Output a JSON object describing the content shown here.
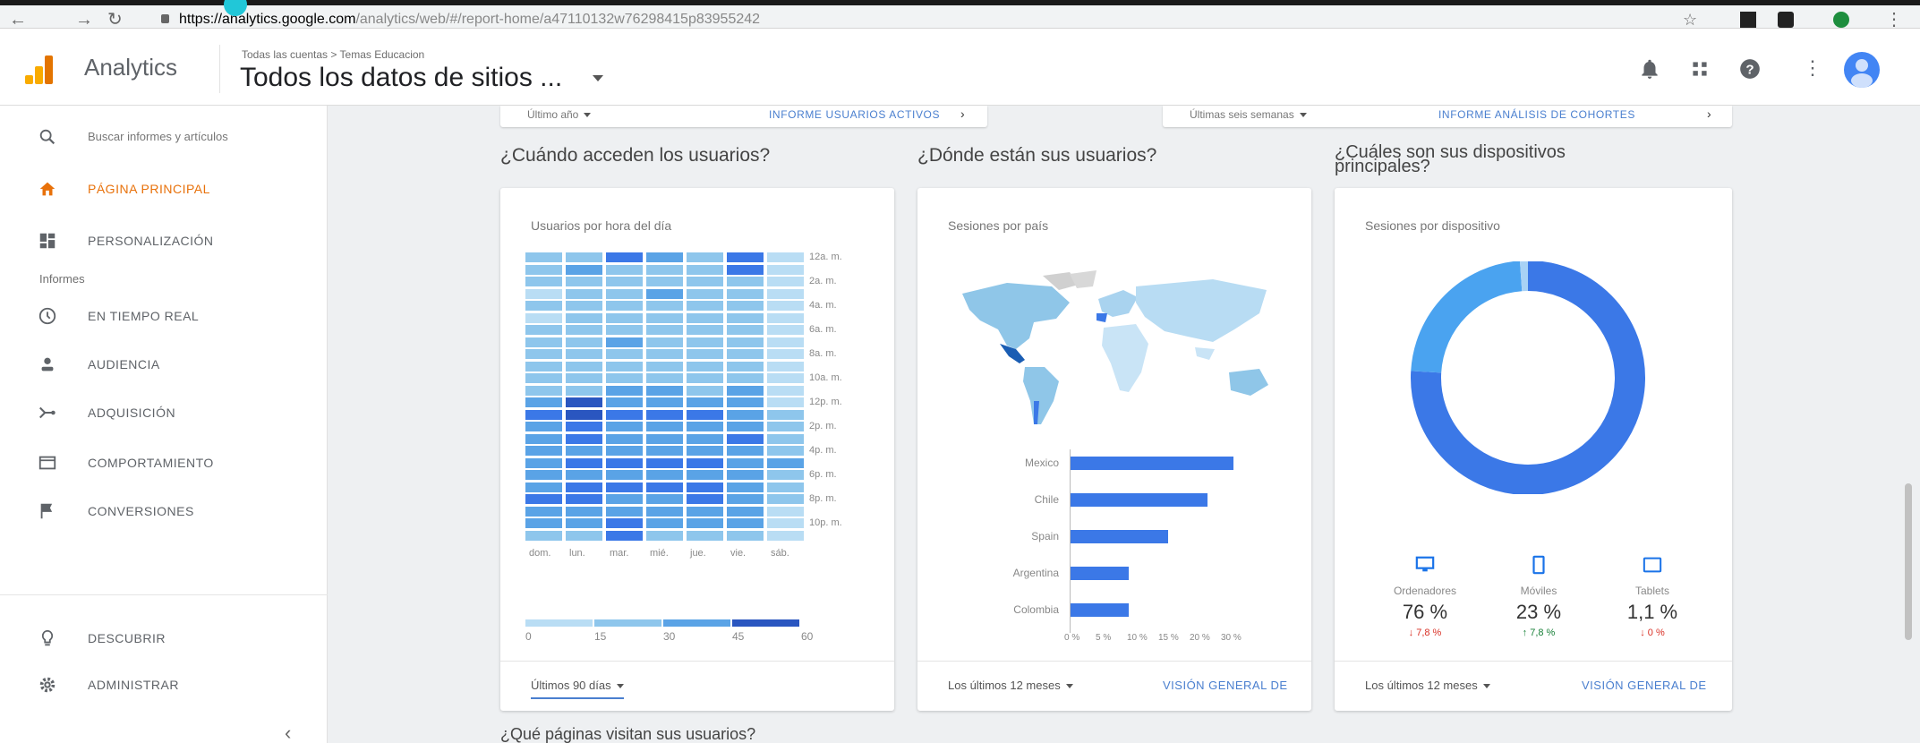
{
  "browser": {
    "url_host": "https://analytics.google.com",
    "url_rest": "/analytics/web/#/report-home/a47110132w76298415p83955242"
  },
  "header": {
    "app_name": "Analytics",
    "breadcrumb": "Todas las cuentas > Temas Educacion",
    "view_name": "Todos los datos de sitios ..."
  },
  "sidebar": {
    "search": "Buscar informes y artículos",
    "home": "PÁGINA PRINCIPAL",
    "customization": "PERSONALIZACIÓN",
    "reports_section": "Informes",
    "realtime": "EN TIEMPO REAL",
    "audience": "AUDIENCIA",
    "acquisition": "ADQUISICIÓN",
    "behavior": "COMPORTAMIENTO",
    "conversions": "CONVERSIONES",
    "discover": "DESCUBRIR",
    "admin": "ADMINISTRAR",
    "collapse": "‹"
  },
  "top_cards": {
    "left_select": "Último año",
    "left_link": "INFORME USUARIOS ACTIVOS",
    "right_select": "Últimas seis semanas",
    "right_link": "INFORME ANÁLISIS DE COHORTES"
  },
  "questions": {
    "when": "¿Cuándo acceden los usuarios?",
    "where": "¿Dónde están sus usuarios?",
    "devices": "¿Cuáles son sus dispositivos principales?",
    "pages": "¿Qué páginas visitan sus usuarios?"
  },
  "when_card": {
    "title": "Usuarios por hora del día",
    "hours": [
      "12a. m.",
      "2a. m.",
      "4a. m.",
      "6a. m.",
      "8a. m.",
      "10a. m.",
      "12p. m.",
      "2p. m.",
      "4p. m.",
      "6p. m.",
      "8p. m.",
      "10p. m."
    ],
    "days": [
      "dom.",
      "lun.",
      "mar.",
      "mié.",
      "jue.",
      "vie.",
      "sáb."
    ],
    "legend": [
      "0",
      "15",
      "30",
      "45",
      "60"
    ],
    "footer": "Últimos 90 días"
  },
  "where_card": {
    "title": "Sesiones por país",
    "footer": "Los últimos 12 meses",
    "link": "VISIÓN GENERAL DE"
  },
  "devices_card": {
    "title": "Sesiones por dispositivo",
    "footer": "Los últimos 12 meses",
    "link": "VISIÓN GENERAL DE",
    "items": [
      {
        "name": "Ordenadores",
        "value": "76 %",
        "change": "↓ 7,8 %",
        "color": "#d93025",
        "icon": "desktop-icon"
      },
      {
        "name": "Móviles",
        "value": "23 %",
        "change": "↑ 7,8 %",
        "color": "#188038",
        "icon": "mobile-icon"
      },
      {
        "name": "Tablets",
        "value": "1,1 %",
        "change": "↓ 0 %",
        "color": "#d93025",
        "icon": "tablet-icon"
      }
    ]
  },
  "chart_data": [
    {
      "type": "heatmap",
      "title": "Usuarios por hora del día",
      "x": [
        "dom.",
        "lun.",
        "mar.",
        "mié.",
        "jue.",
        "vie.",
        "sáb."
      ],
      "y": [
        "12a. m.",
        "",
        "2a. m.",
        "",
        "4a. m.",
        "",
        "6a. m.",
        "",
        "8a. m.",
        "",
        "10a. m.",
        "",
        "12p. m.",
        "",
        "2p. m.",
        "",
        "4p. m.",
        "",
        "6p. m.",
        "",
        "8p. m.",
        "",
        "10p. m.",
        ""
      ],
      "values": [
        [
          2,
          2,
          4,
          3,
          2,
          4,
          1
        ],
        [
          2,
          3,
          2,
          2,
          2,
          4,
          1
        ],
        [
          2,
          2,
          2,
          2,
          2,
          2,
          1
        ],
        [
          1,
          2,
          2,
          3,
          2,
          2,
          1
        ],
        [
          2,
          2,
          2,
          2,
          2,
          2,
          1
        ],
        [
          1,
          2,
          2,
          2,
          2,
          2,
          1
        ],
        [
          2,
          2,
          2,
          2,
          2,
          2,
          1
        ],
        [
          2,
          2,
          3,
          2,
          2,
          2,
          1
        ],
        [
          2,
          2,
          2,
          2,
          2,
          2,
          1
        ],
        [
          2,
          2,
          2,
          2,
          2,
          2,
          1
        ],
        [
          2,
          2,
          2,
          2,
          2,
          2,
          1
        ],
        [
          2,
          2,
          3,
          3,
          2,
          3,
          1
        ],
        [
          3,
          5,
          3,
          3,
          3,
          3,
          1
        ],
        [
          4,
          5,
          4,
          4,
          4,
          3,
          2
        ],
        [
          3,
          4,
          3,
          3,
          3,
          3,
          2
        ],
        [
          3,
          4,
          3,
          3,
          3,
          4,
          2
        ],
        [
          3,
          3,
          3,
          3,
          3,
          3,
          2
        ],
        [
          3,
          4,
          4,
          4,
          4,
          3,
          3
        ],
        [
          3,
          3,
          3,
          3,
          3,
          3,
          2
        ],
        [
          3,
          4,
          4,
          4,
          4,
          3,
          2
        ],
        [
          4,
          4,
          3,
          3,
          4,
          3,
          2
        ],
        [
          3,
          3,
          3,
          3,
          3,
          3,
          1
        ],
        [
          3,
          3,
          4,
          3,
          3,
          3,
          1
        ],
        [
          2,
          2,
          4,
          2,
          2,
          2,
          1
        ]
      ],
      "legend": [
        "0",
        "15",
        "30",
        "45",
        "60"
      ]
    },
    {
      "type": "bar",
      "title": "Sesiones por país",
      "categories": [
        "Mexico",
        "Chile",
        "Spain",
        "Argentina",
        "Colombia"
      ],
      "values": [
        25,
        21,
        15,
        9,
        9
      ],
      "xlim": [
        0,
        30
      ],
      "xticks": [
        "0 %",
        "5 %",
        "10 %",
        "15 %",
        "20 %",
        "30 %"
      ]
    },
    {
      "type": "pie",
      "title": "Sesiones por dispositivo",
      "categories": [
        "Ordenadores",
        "Móviles",
        "Tablets"
      ],
      "values": [
        76,
        23,
        1.1
      ],
      "colors": [
        "#3b78e7",
        "#4aa3f0",
        "#a8d2f5"
      ]
    }
  ]
}
